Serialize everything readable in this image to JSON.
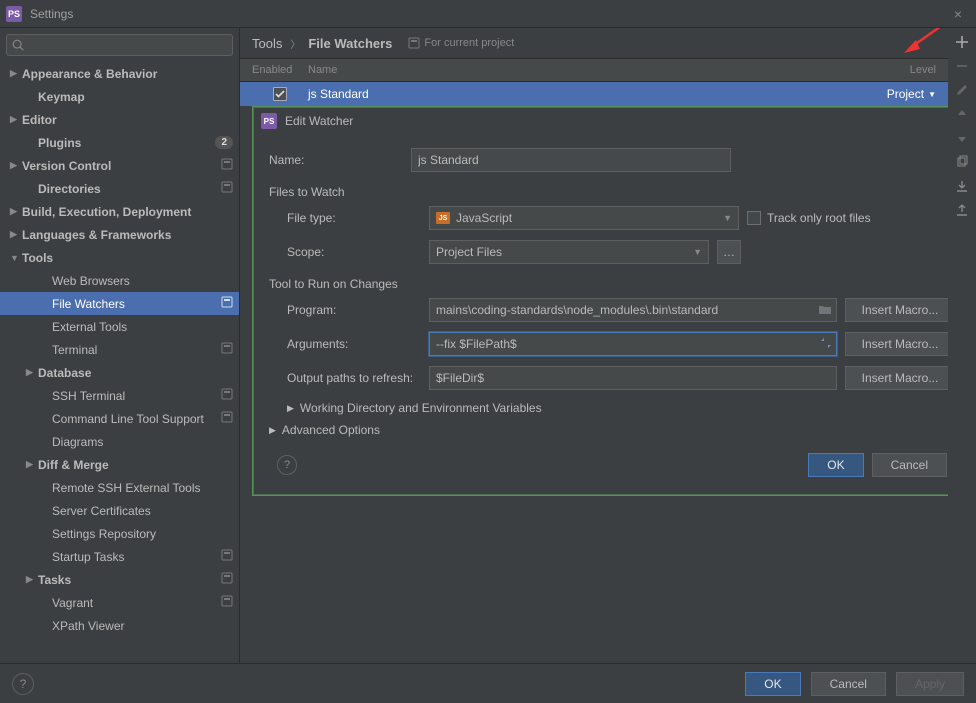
{
  "window": {
    "title": "Settings"
  },
  "search": {
    "placeholder": ""
  },
  "sidebar": {
    "items": [
      {
        "label": "Appearance & Behavior",
        "arrow": "▶",
        "level": 0,
        "bold": true
      },
      {
        "label": "Keymap",
        "arrow": "",
        "level": 1,
        "bold": true
      },
      {
        "label": "Editor",
        "arrow": "▶",
        "level": 0,
        "bold": true
      },
      {
        "label": "Plugins",
        "arrow": "",
        "level": 1,
        "bold": true,
        "badge": "2"
      },
      {
        "label": "Version Control",
        "arrow": "▶",
        "level": 0,
        "bold": true,
        "proj": true
      },
      {
        "label": "Directories",
        "arrow": "",
        "level": 1,
        "bold": true,
        "proj": true
      },
      {
        "label": "Build, Execution, Deployment",
        "arrow": "▶",
        "level": 0,
        "bold": true
      },
      {
        "label": "Languages & Frameworks",
        "arrow": "▶",
        "level": 0,
        "bold": true
      },
      {
        "label": "Tools",
        "arrow": "▼",
        "level": 0,
        "bold": true
      },
      {
        "label": "Web Browsers",
        "arrow": "",
        "level": 2
      },
      {
        "label": "File Watchers",
        "arrow": "",
        "level": 2,
        "selected": true,
        "proj": true
      },
      {
        "label": "External Tools",
        "arrow": "",
        "level": 2
      },
      {
        "label": "Terminal",
        "arrow": "",
        "level": 2,
        "proj": true
      },
      {
        "label": "Database",
        "arrow": "▶",
        "level": 1,
        "bold": true
      },
      {
        "label": "SSH Terminal",
        "arrow": "",
        "level": 2,
        "proj": true
      },
      {
        "label": "Command Line Tool Support",
        "arrow": "",
        "level": 2,
        "proj": true
      },
      {
        "label": "Diagrams",
        "arrow": "",
        "level": 2
      },
      {
        "label": "Diff & Merge",
        "arrow": "▶",
        "level": 1,
        "bold": true
      },
      {
        "label": "Remote SSH External Tools",
        "arrow": "",
        "level": 2
      },
      {
        "label": "Server Certificates",
        "arrow": "",
        "level": 2
      },
      {
        "label": "Settings Repository",
        "arrow": "",
        "level": 2
      },
      {
        "label": "Startup Tasks",
        "arrow": "",
        "level": 2,
        "proj": true
      },
      {
        "label": "Tasks",
        "arrow": "▶",
        "level": 1,
        "bold": true,
        "proj": true
      },
      {
        "label": "Vagrant",
        "arrow": "",
        "level": 2,
        "proj": true
      },
      {
        "label": "XPath Viewer",
        "arrow": "",
        "level": 2
      }
    ]
  },
  "breadcrumb": {
    "root": "Tools",
    "leaf": "File Watchers",
    "project_note": "For current project"
  },
  "table": {
    "headers": {
      "enabled": "Enabled",
      "name": "Name",
      "level": "Level"
    },
    "rows": [
      {
        "enabled": true,
        "name": "js Standard",
        "level": "Project"
      }
    ]
  },
  "dialog": {
    "title": "Edit Watcher",
    "name_label": "Name:",
    "name_value": "js Standard",
    "files_section": "Files to Watch",
    "file_type_label": "File type:",
    "file_type_value": "JavaScript",
    "scope_label": "Scope:",
    "scope_value": "Project Files",
    "track_root_label": "Track only root files",
    "tool_section": "Tool to Run on Changes",
    "program_label": "Program:",
    "program_value": "mains\\coding-standards\\node_modules\\.bin\\standard",
    "arguments_label": "Arguments:",
    "arguments_value": "--fix $FilePath$",
    "output_label": "Output paths to refresh:",
    "output_value": "$FileDir$",
    "insert_macro": "Insert Macro...",
    "working_dir": "Working Directory and Environment Variables",
    "advanced": "Advanced Options",
    "ok": "OK",
    "cancel": "Cancel"
  },
  "footer": {
    "ok": "OK",
    "cancel": "Cancel",
    "apply": "Apply"
  }
}
